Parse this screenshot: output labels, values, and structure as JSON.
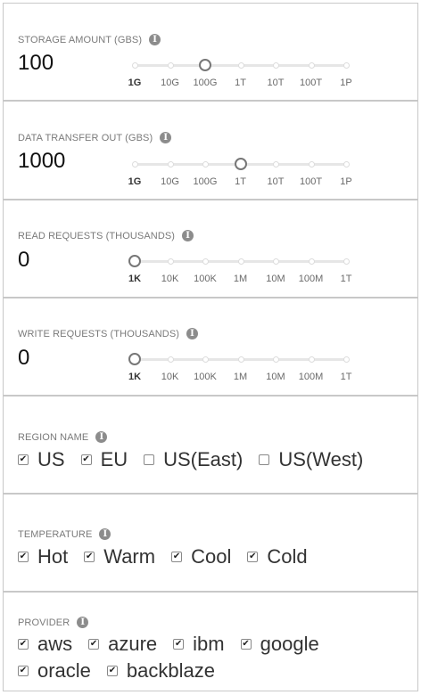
{
  "storage": {
    "label": "STORAGE AMOUNT (GBS)",
    "value": "100",
    "ticks": [
      "1G",
      "10G",
      "100G",
      "1T",
      "10T",
      "100T",
      "1P"
    ],
    "selected_index": 2
  },
  "transfer": {
    "label": "DATA TRANSFER OUT (GBS)",
    "value": "1000",
    "ticks": [
      "1G",
      "10G",
      "100G",
      "1T",
      "10T",
      "100T",
      "1P"
    ],
    "selected_index": 3
  },
  "read": {
    "label": "READ REQUESTS (THOUSANDS)",
    "value": "0",
    "ticks": [
      "1K",
      "10K",
      "100K",
      "1M",
      "10M",
      "100M",
      "1T"
    ],
    "selected_index": 0
  },
  "write": {
    "label": "WRITE REQUESTS (THOUSANDS)",
    "value": "0",
    "ticks": [
      "1K",
      "10K",
      "100K",
      "1M",
      "10M",
      "100M",
      "1T"
    ],
    "selected_index": 0
  },
  "region": {
    "label": "REGION NAME",
    "options": [
      {
        "label": "US",
        "checked": true
      },
      {
        "label": "EU",
        "checked": true
      },
      {
        "label": "US(East)",
        "checked": false
      },
      {
        "label": "US(West)",
        "checked": false
      }
    ]
  },
  "temperature": {
    "label": "TEMPERATURE",
    "options": [
      {
        "label": "Hot",
        "checked": true
      },
      {
        "label": "Warm",
        "checked": true
      },
      {
        "label": "Cool",
        "checked": true
      },
      {
        "label": "Cold",
        "checked": true
      }
    ]
  },
  "provider": {
    "label": "PROVIDER",
    "options": [
      {
        "label": "aws",
        "checked": true
      },
      {
        "label": "azure",
        "checked": true
      },
      {
        "label": "ibm",
        "checked": true
      },
      {
        "label": "google",
        "checked": true
      },
      {
        "label": "oracle",
        "checked": true
      },
      {
        "label": "backblaze",
        "checked": true
      }
    ]
  }
}
